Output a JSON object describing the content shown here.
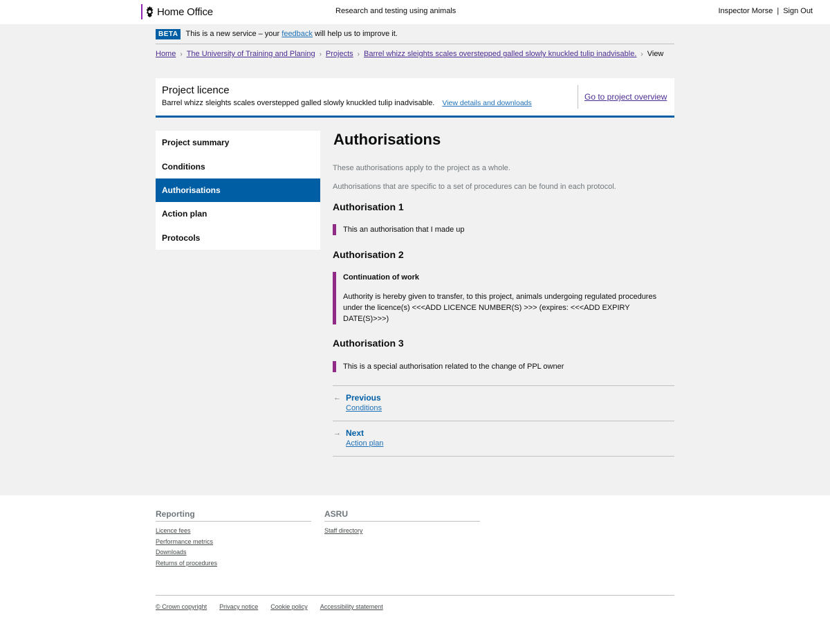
{
  "header": {
    "logo_text": "Home Office",
    "service_name": "Research and testing using animals",
    "user_name": "Inspector Morse",
    "separator": "|",
    "sign_out": "Sign Out"
  },
  "beta": {
    "tag": "BETA",
    "text_before": "This is a new service – your ",
    "link": "feedback",
    "text_after": " will help us to improve it."
  },
  "breadcrumb": {
    "items": [
      "Home",
      "The University of Training and Planing",
      "Projects",
      "Barrel whizz sleights scales overstepped galled slowly knuckled tulip inadvisable."
    ],
    "current": "View"
  },
  "licence": {
    "type": "Project licence",
    "title": "Barrel whizz sleights scales overstepped galled slowly knuckled tulip inadvisable.",
    "details_link": "View details and downloads",
    "overview_link": "Go to project overview"
  },
  "sidenav": {
    "items": [
      "Project summary",
      "Conditions",
      "Authorisations",
      "Action plan",
      "Protocols"
    ],
    "active": "Authorisations"
  },
  "content": {
    "title": "Authorisations",
    "intro1": "These authorisations apply to the project as a whole.",
    "intro2": "Authorisations that are specific to a set of procedures can be found in each protocol.",
    "authorisations": [
      {
        "heading": "Authorisation 1",
        "title": "",
        "text": "This an authorisation that I made up"
      },
      {
        "heading": "Authorisation 2",
        "title": "Continuation of work",
        "text": "Authority is hereby given to transfer, to this project, animals undergoing regulated procedures under the licence(s) <<<ADD LICENCE NUMBER(S) >>> (expires: <<<ADD EXPIRY DATE(S)>>>)"
      },
      {
        "heading": "Authorisation 3",
        "title": "",
        "text": "This is a special authorisation related to the change of PPL owner"
      }
    ]
  },
  "pager": {
    "previous_label": "Previous",
    "previous_target": "Conditions",
    "next_label": "Next",
    "next_target": "Action plan"
  },
  "footer": {
    "columns": [
      {
        "heading": "Reporting",
        "links": [
          "Licence fees",
          "Performance metrics",
          "Downloads",
          "Returns of procedures"
        ]
      },
      {
        "heading": "ASRU",
        "links": [
          "Staff directory"
        ]
      }
    ],
    "bottom_links": [
      "© Crown copyright",
      "Privacy notice",
      "Cookie policy",
      "Accessibility statement"
    ]
  },
  "colors": {
    "brand_blue": "#005ea5",
    "link_purple": "#4c2c92",
    "inset_purple": "#912b88",
    "background_grey": "#f1f1f1"
  }
}
